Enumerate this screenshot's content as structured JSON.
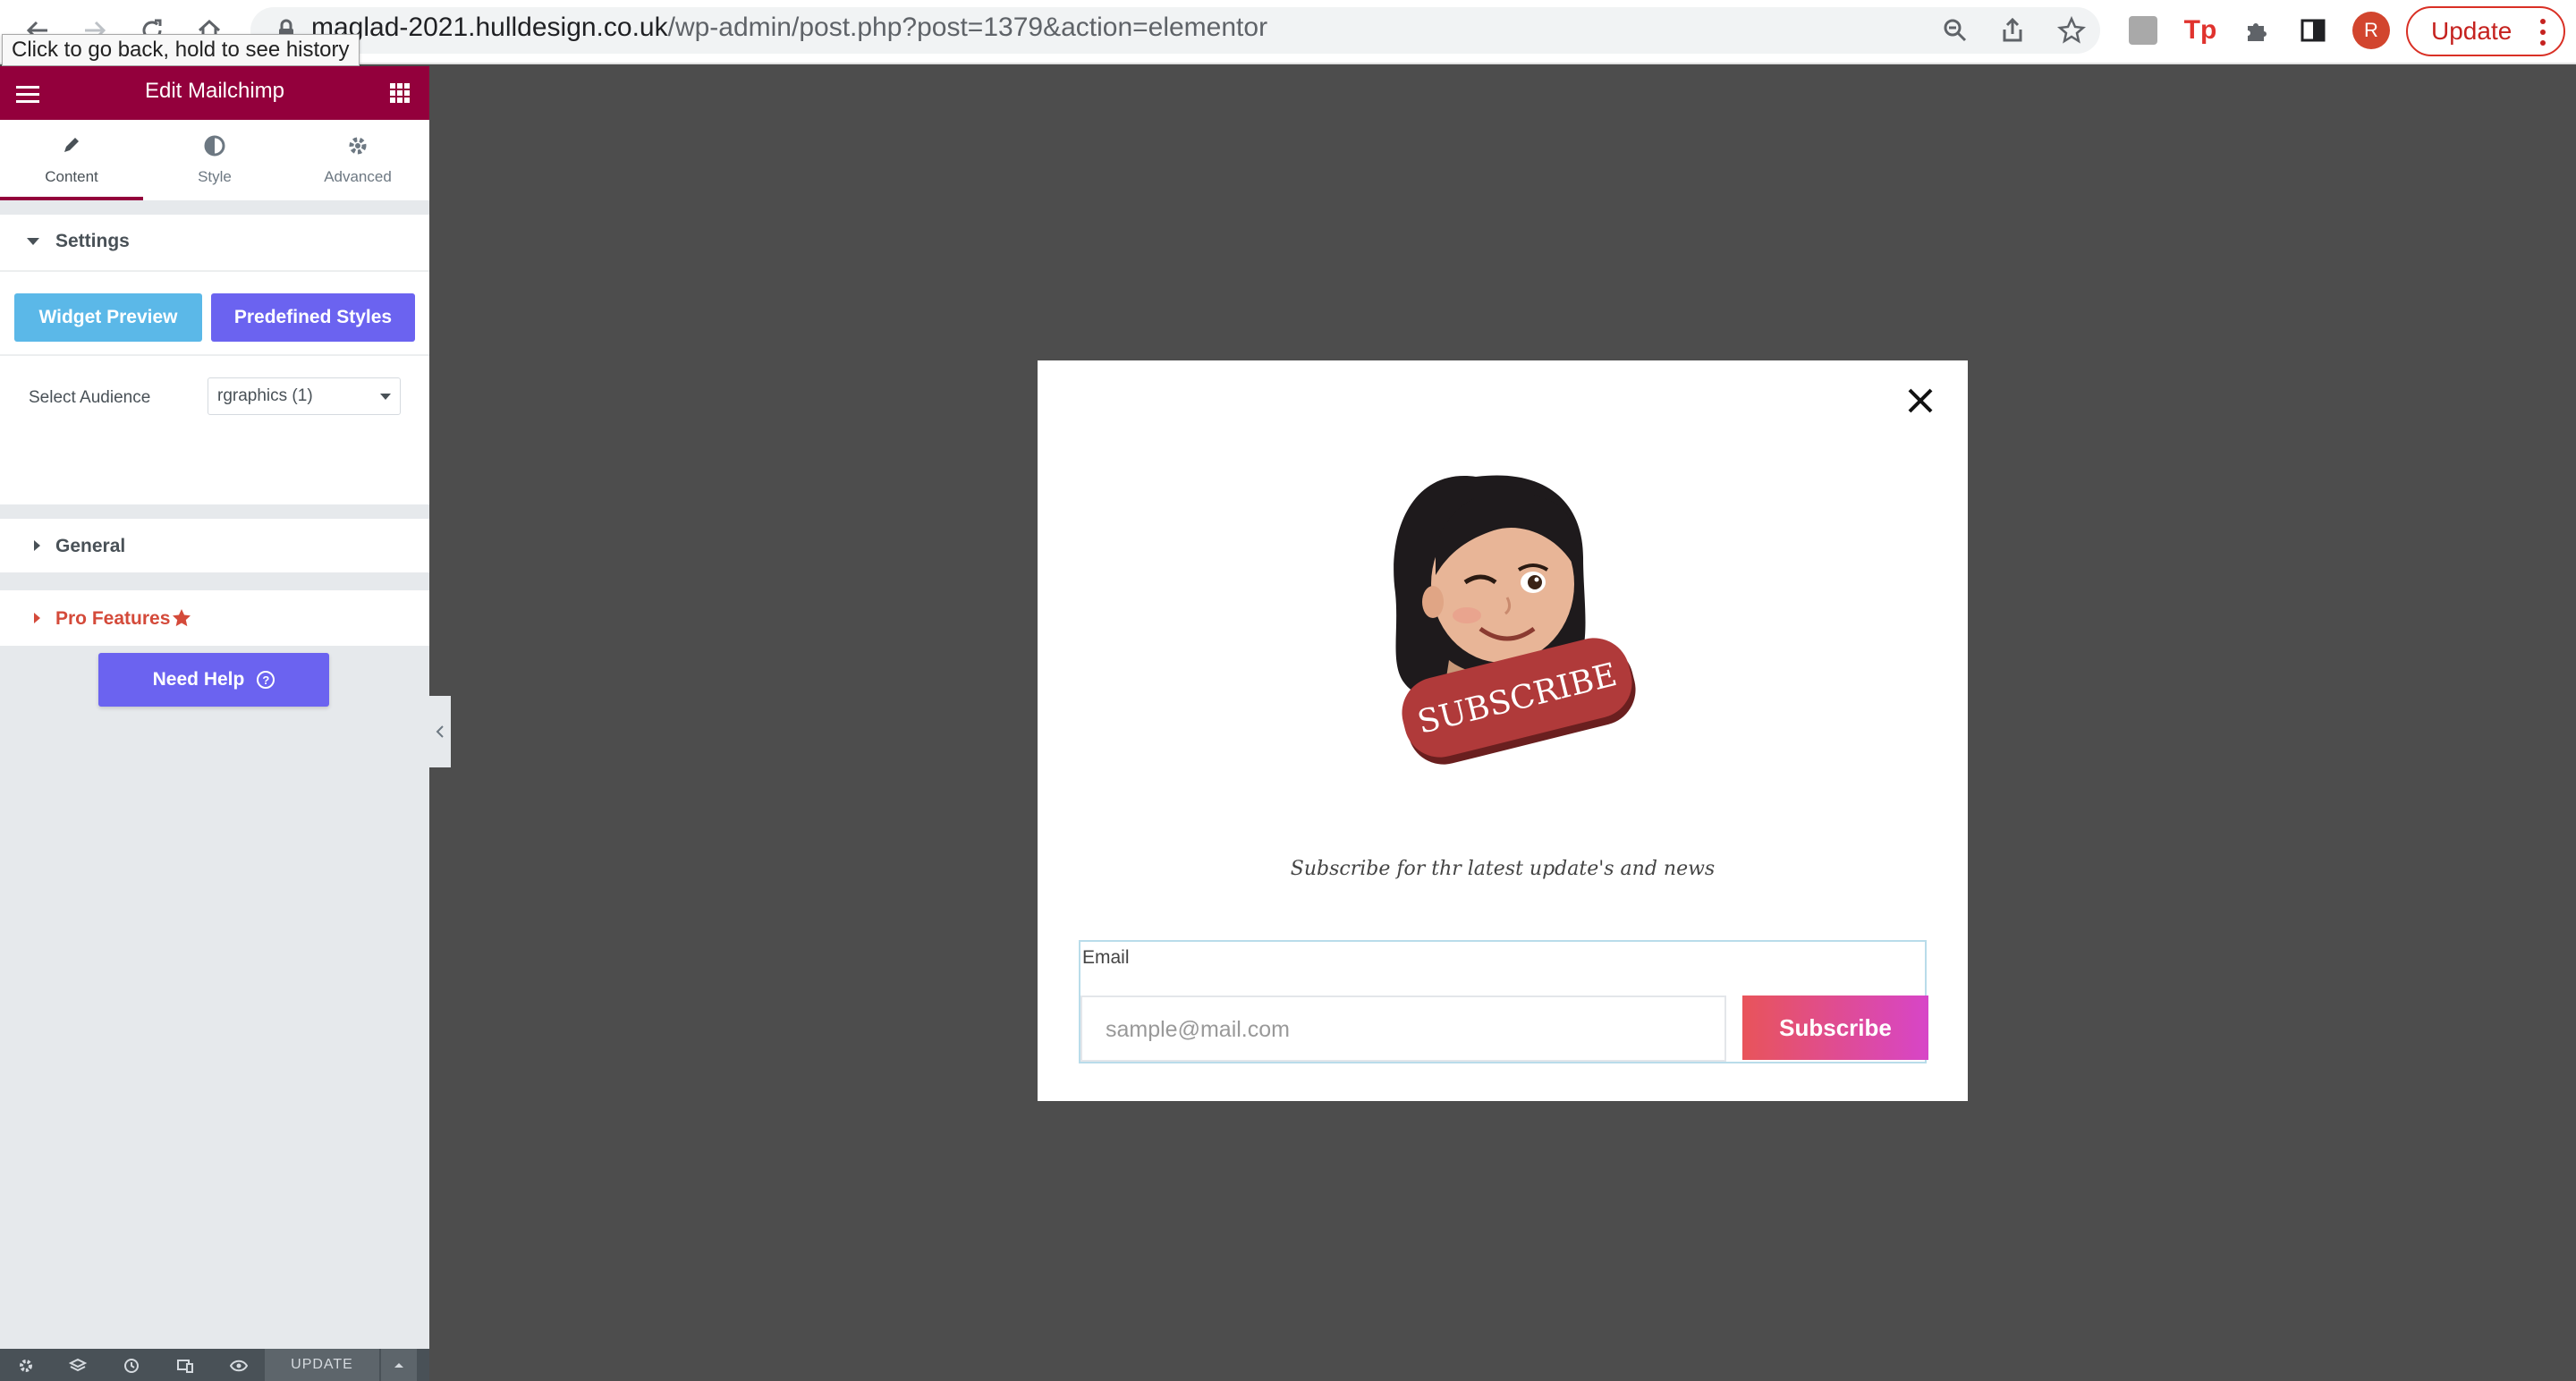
{
  "browser": {
    "url_host": "maglad-2021.hulldesign.co.uk",
    "url_path": "/wp-admin/post.php?post=1379&action=elementor",
    "tooltip": "Click to go back, hold to see history",
    "profile_initial": "R",
    "update_label": "Update",
    "extensions": [
      "zoom-icon",
      "share-icon",
      "bookmark-star-icon",
      "extension-gray-icon",
      "tp-extension-icon",
      "puzzle-icon",
      "sidepanel-icon"
    ],
    "tp_label": "Tp"
  },
  "panel": {
    "title": "Edit Mailchimp",
    "tabs": [
      {
        "label": "Content",
        "icon": "pencil-icon"
      },
      {
        "label": "Style",
        "icon": "half-circle-icon"
      },
      {
        "label": "Advanced",
        "icon": "gear-icon"
      }
    ],
    "settings": {
      "title": "Settings",
      "widget_preview_label": "Widget Preview",
      "predefined_styles_label": "Predefined Styles",
      "audience_label": "Select Audience",
      "audience_value": "rgraphics (1)"
    },
    "general_title": "General",
    "pro_features_title": "Pro Features",
    "need_help_label": "Need Help",
    "help_glyph": "?",
    "footer_update_label": "UPDATE"
  },
  "popup": {
    "badge_text": "SUBSCRIBE",
    "tagline": "Subscribe for thr latest update's and news",
    "email_label": "Email",
    "email_placeholder": "sample@mail.com",
    "subscribe_label": "Subscribe"
  },
  "colors": {
    "panel_header": "#93003c",
    "pro_accent": "#d44a3a",
    "preview_button": "#5bb8e8",
    "predefined_button": "#6b63f0",
    "badge": "#b03a3a"
  }
}
